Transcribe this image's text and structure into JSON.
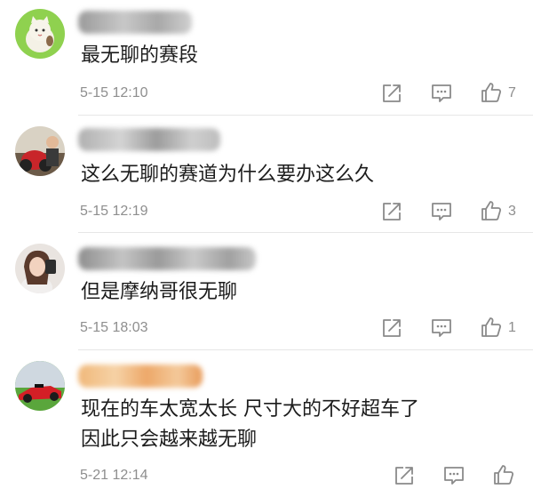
{
  "comments": [
    {
      "text": "最无聊的赛段",
      "time": "5-15 12:10",
      "likes": "7"
    },
    {
      "text": "这么无聊的赛道为什么要办这么久",
      "time": "5-15 12:19",
      "likes": "3"
    },
    {
      "text": "但是摩纳哥很无聊",
      "time": "5-15 18:03",
      "likes": "1"
    },
    {
      "text_line1": "现在的车太宽太长 尺寸大的不好超车了",
      "text_line2": "因此只会越来越无聊",
      "time": "5-21 12:14",
      "likes": ""
    }
  ],
  "icons": {
    "share": "share-icon",
    "comment": "comment-icon",
    "like": "thumbs-up-icon"
  },
  "colors": {
    "meta_text": "#8e8e8e",
    "icon": "#8a8a8a",
    "divider": "#e6e6e6"
  }
}
